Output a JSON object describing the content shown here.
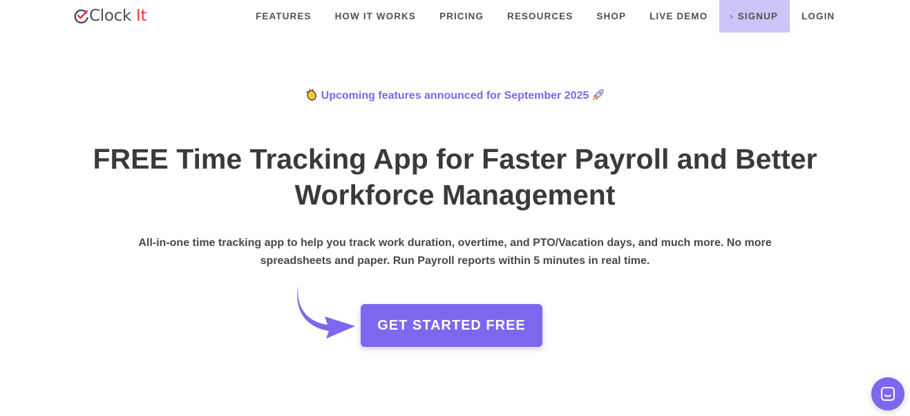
{
  "brand": {
    "name_prefix": "Clock",
    "name_suffix": " It",
    "accent_color": "#e8353d"
  },
  "nav": {
    "items": [
      {
        "label": "FEATURES"
      },
      {
        "label": "HOW IT WORKS"
      },
      {
        "label": "PRICING"
      },
      {
        "label": "RESOURCES"
      },
      {
        "label": "SHOP"
      },
      {
        "label": "LIVE DEMO"
      },
      {
        "label": "SIGNUP",
        "icon": "chevron-right-icon",
        "highlight_color": "#cdc5f7"
      },
      {
        "label": "LOGIN"
      }
    ]
  },
  "announcement": {
    "text": "Upcoming features announced for September 2025",
    "leading_icon": "clapping-hands-icon",
    "trailing_icon": "rocket-icon"
  },
  "hero": {
    "title": "FREE Time Tracking App for Faster Payroll and Better Workforce Management",
    "subtitle": "All-in-one time tracking app to help you track work duration, overtime, and PTO/Vacation days, and much more. No more spreadsheets and paper. Run Payroll reports within 5 minutes in real time.",
    "cta_label": "GET STARTED FREE",
    "cta_color": "#7b68ee"
  },
  "chat_widget": {
    "icon": "chat-bubble-icon"
  }
}
